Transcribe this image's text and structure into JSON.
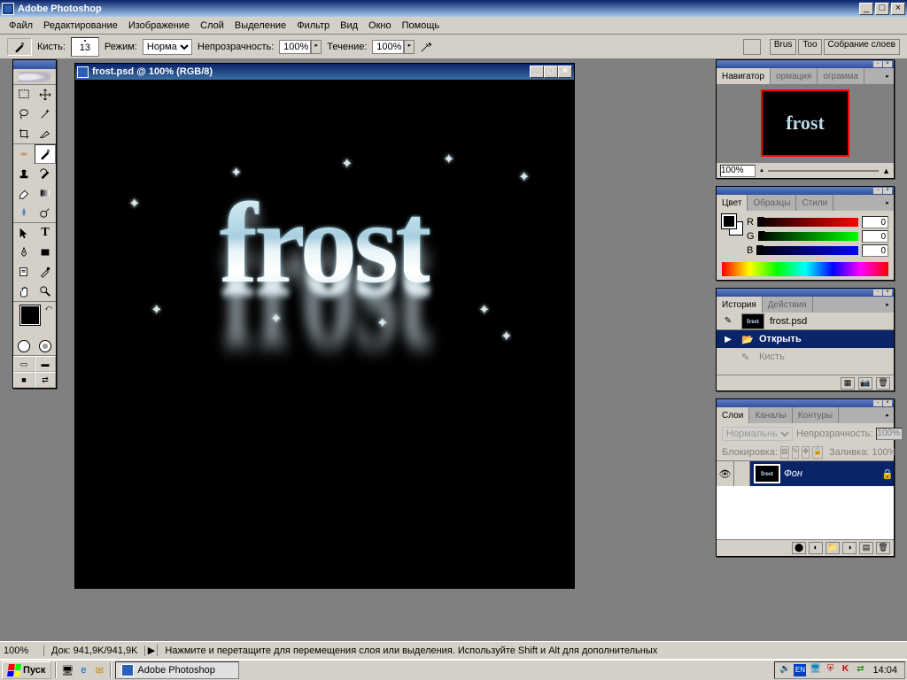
{
  "app": {
    "title": "Adobe Photoshop"
  },
  "menu": [
    "Файл",
    "Редактирование",
    "Изображение",
    "Слой",
    "Выделение",
    "Фильтр",
    "Вид",
    "Окно",
    "Помощь"
  ],
  "options": {
    "brush_label": "Кисть:",
    "brush_size": "13",
    "mode_label": "Режим:",
    "mode_value": "Норма",
    "opacity_label": "Непрозрачность:",
    "opacity_value": "100%",
    "flow_label": "Течение:",
    "flow_value": "100%",
    "palette_buttons": [
      "Brus",
      "Too",
      "Собрание слоев"
    ]
  },
  "document": {
    "title": "frost.psd @ 100% (RGB/8)",
    "text": "frost"
  },
  "navigator": {
    "tabs": [
      "Навигатор",
      "ормация",
      "ограмма"
    ],
    "zoom": "100%"
  },
  "color": {
    "tabs": [
      "Цвет",
      "Образцы",
      "Стили"
    ],
    "channels": [
      {
        "label": "R",
        "value": "0"
      },
      {
        "label": "G",
        "value": "0"
      },
      {
        "label": "B",
        "value": "0"
      }
    ]
  },
  "history": {
    "tabs": [
      "История",
      "Действия"
    ],
    "snapshot": "frost.psd",
    "items": [
      {
        "label": "Открыть",
        "selected": true,
        "icon": "▶"
      },
      {
        "label": "Кисть",
        "selected": false,
        "icon": ""
      }
    ]
  },
  "layers": {
    "tabs": [
      "Слои",
      "Каналы",
      "Контуры"
    ],
    "blend_mode": "Нормальный",
    "opacity_label": "Непрозрачность:",
    "opacity_value": "100%",
    "lock_label": "Блокировка:",
    "fill_label": "Заливка:",
    "fill_value": "100%",
    "layer_name": "Фон"
  },
  "status": {
    "zoom": "100%",
    "doc_label": "Док:",
    "doc_size": "941,9K/941,9K",
    "hint": "Нажмите и перетащите для перемещения слоя или выделения. Используйте Shift и Alt для дополнительных"
  },
  "taskbar": {
    "start": "Пуск",
    "active_task": "Adobe Photoshop",
    "tray": {
      "lang": "EN"
    },
    "clock": "14:04"
  }
}
